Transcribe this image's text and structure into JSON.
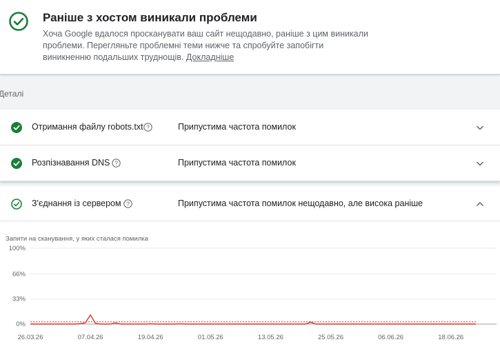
{
  "banner": {
    "title": "Раніше з хостом виникали проблеми",
    "text": "Хоча Google вдалося просканувати ваш сайт нещодавно, раніше з цим виникали проблеми. Перегляньте проблемні теми нижче та спробуйте запобігти виникненню подальших труднощів.",
    "link": "Докладніше",
    "icon": "check-circle-icon",
    "accent": "#188038"
  },
  "details_label": "Деталі",
  "rows": [
    {
      "title": "Отримання файлу robots.txt",
      "status": "Припустима частота помилок",
      "icon": "check-circle-filled-icon",
      "expanded": false
    },
    {
      "title": "Розпізнавання DNS",
      "status": "Припустима частота помилок",
      "icon": "check-circle-filled-icon",
      "expanded": false
    },
    {
      "title": "З'єднання із сервером",
      "status": "Припустима частота помилок нещодавно, але висока раніше",
      "icon": "check-circle-outline-icon",
      "expanded": true
    }
  ],
  "chart_data": {
    "type": "line",
    "ylabel": "Запити на сканування, у яких сталася помилка",
    "y_ticks": [
      "100%",
      "66%",
      "33%",
      "0%"
    ],
    "ylim": [
      0,
      100
    ],
    "x_ticks": [
      "26.03.26",
      "07.04.26",
      "19.04.26",
      "01.05.26",
      "13.05.26",
      "25.05.26",
      "06.06.26",
      "18.06.26"
    ],
    "x_tick_days": [
      0,
      12,
      24,
      36,
      48,
      60,
      72,
      84
    ],
    "threshold": 3,
    "line_color": "#d93025",
    "series": [
      {
        "x": [
          0,
          1,
          2,
          3,
          4,
          5,
          6,
          7,
          8,
          9,
          10,
          11,
          12,
          13,
          14,
          15,
          16,
          17,
          18,
          19,
          20,
          21,
          22,
          23,
          24,
          25,
          26,
          27,
          28,
          29,
          30,
          31,
          32,
          33,
          34,
          35,
          36,
          37,
          38,
          39,
          40,
          41,
          42,
          43,
          44,
          45,
          46,
          47,
          48,
          49,
          50,
          51,
          52,
          53,
          54,
          55,
          56,
          57,
          58,
          59,
          60,
          61,
          62,
          63,
          64,
          65,
          66,
          67,
          68,
          69,
          70,
          71,
          72,
          73,
          74,
          75,
          76,
          77,
          78,
          79,
          80,
          81,
          82,
          83,
          84,
          85,
          86,
          87,
          88,
          89
        ],
        "values": [
          0,
          0,
          0,
          0,
          0,
          0,
          0,
          0,
          0,
          0,
          0.5,
          1.5,
          12,
          1,
          0,
          0,
          0,
          1.5,
          0,
          0,
          0,
          0,
          0,
          0,
          0.3,
          0,
          0,
          0,
          0,
          0,
          0.3,
          0,
          0,
          0,
          0,
          0,
          0,
          0,
          0,
          0,
          0,
          0,
          0,
          0,
          0,
          0,
          0,
          0,
          0,
          0,
          0,
          0,
          0,
          0,
          0,
          0,
          2.5,
          0,
          0,
          0,
          0,
          0,
          0,
          0,
          0,
          0,
          0,
          0,
          0,
          0,
          0,
          0,
          0,
          0,
          0,
          0,
          0,
          0,
          0,
          0,
          0,
          0,
          0,
          0,
          0,
          0,
          0,
          0,
          0,
          0
        ]
      }
    ]
  }
}
